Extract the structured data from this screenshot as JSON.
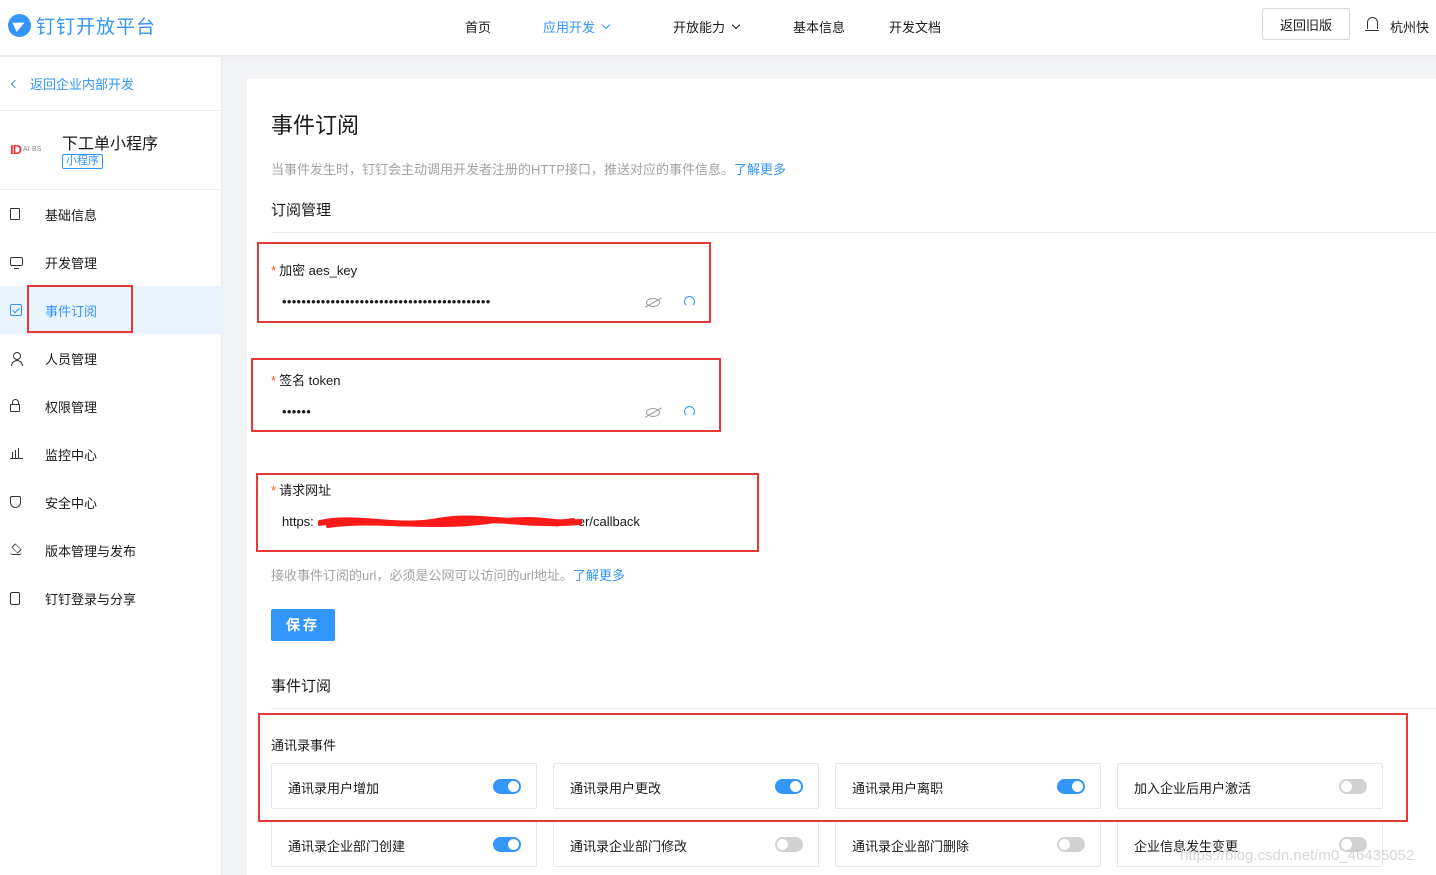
{
  "header": {
    "logo_text": "钉钉开放平台",
    "nav": [
      {
        "label": "首页"
      },
      {
        "label": "应用开发"
      },
      {
        "label": "开放能力"
      },
      {
        "label": "基本信息"
      },
      {
        "label": "开发文档"
      }
    ],
    "old_version_btn": "返回旧版",
    "org_name": "杭州快"
  },
  "sidebar": {
    "back_link": "返回企业内部开发",
    "app_logo_main": "ID",
    "app_logo_sub": "AI·BS",
    "app_name": "下工单小程序",
    "app_tag": "小程序",
    "items": [
      {
        "label": "基础信息"
      },
      {
        "label": "开发管理"
      },
      {
        "label": "事件订阅"
      },
      {
        "label": "人员管理"
      },
      {
        "label": "权限管理"
      },
      {
        "label": "监控中心"
      },
      {
        "label": "安全中心"
      },
      {
        "label": "版本管理与发布"
      },
      {
        "label": "钉钉登录与分享"
      }
    ]
  },
  "main": {
    "title": "事件订阅",
    "desc": "当事件发生时，钉钉会主动调用开发者注册的HTTP接口，推送对应的事件信息。",
    "desc_link": "了解更多",
    "subscribe_mgmt": "订阅管理",
    "aes_key": {
      "label": "加密 aes_key",
      "value": "•••••••••••••••••••••••••••••••••••••••••••"
    },
    "token": {
      "label": "签名 token",
      "value": "••••••"
    },
    "url": {
      "label": "请求网址",
      "value_prefix": "https:",
      "value_suffix": "er/callback"
    },
    "required_mark": "*",
    "url_hint": "接收事件订阅的url，必须是公网可以访问的url地址。",
    "url_hint_link": "了解更多",
    "save_btn": "保存",
    "event_section": "事件订阅",
    "group_label": "通讯录事件",
    "events": [
      {
        "label": "通讯录用户增加",
        "on": true
      },
      {
        "label": "通讯录用户更改",
        "on": true
      },
      {
        "label": "通讯录用户离职",
        "on": true
      },
      {
        "label": "加入企业后用户激活",
        "on": false
      },
      {
        "label": "通讯录企业部门创建",
        "on": true
      },
      {
        "label": "通讯录企业部门修改",
        "on": false
      },
      {
        "label": "通讯录企业部门删除",
        "on": false
      },
      {
        "label": "企业信息发生变更",
        "on": false
      }
    ]
  },
  "watermark": "https://blog.csdn.net/m0_46435052",
  "colors": {
    "accent": "#3296fa",
    "highlight": "#e53935"
  }
}
